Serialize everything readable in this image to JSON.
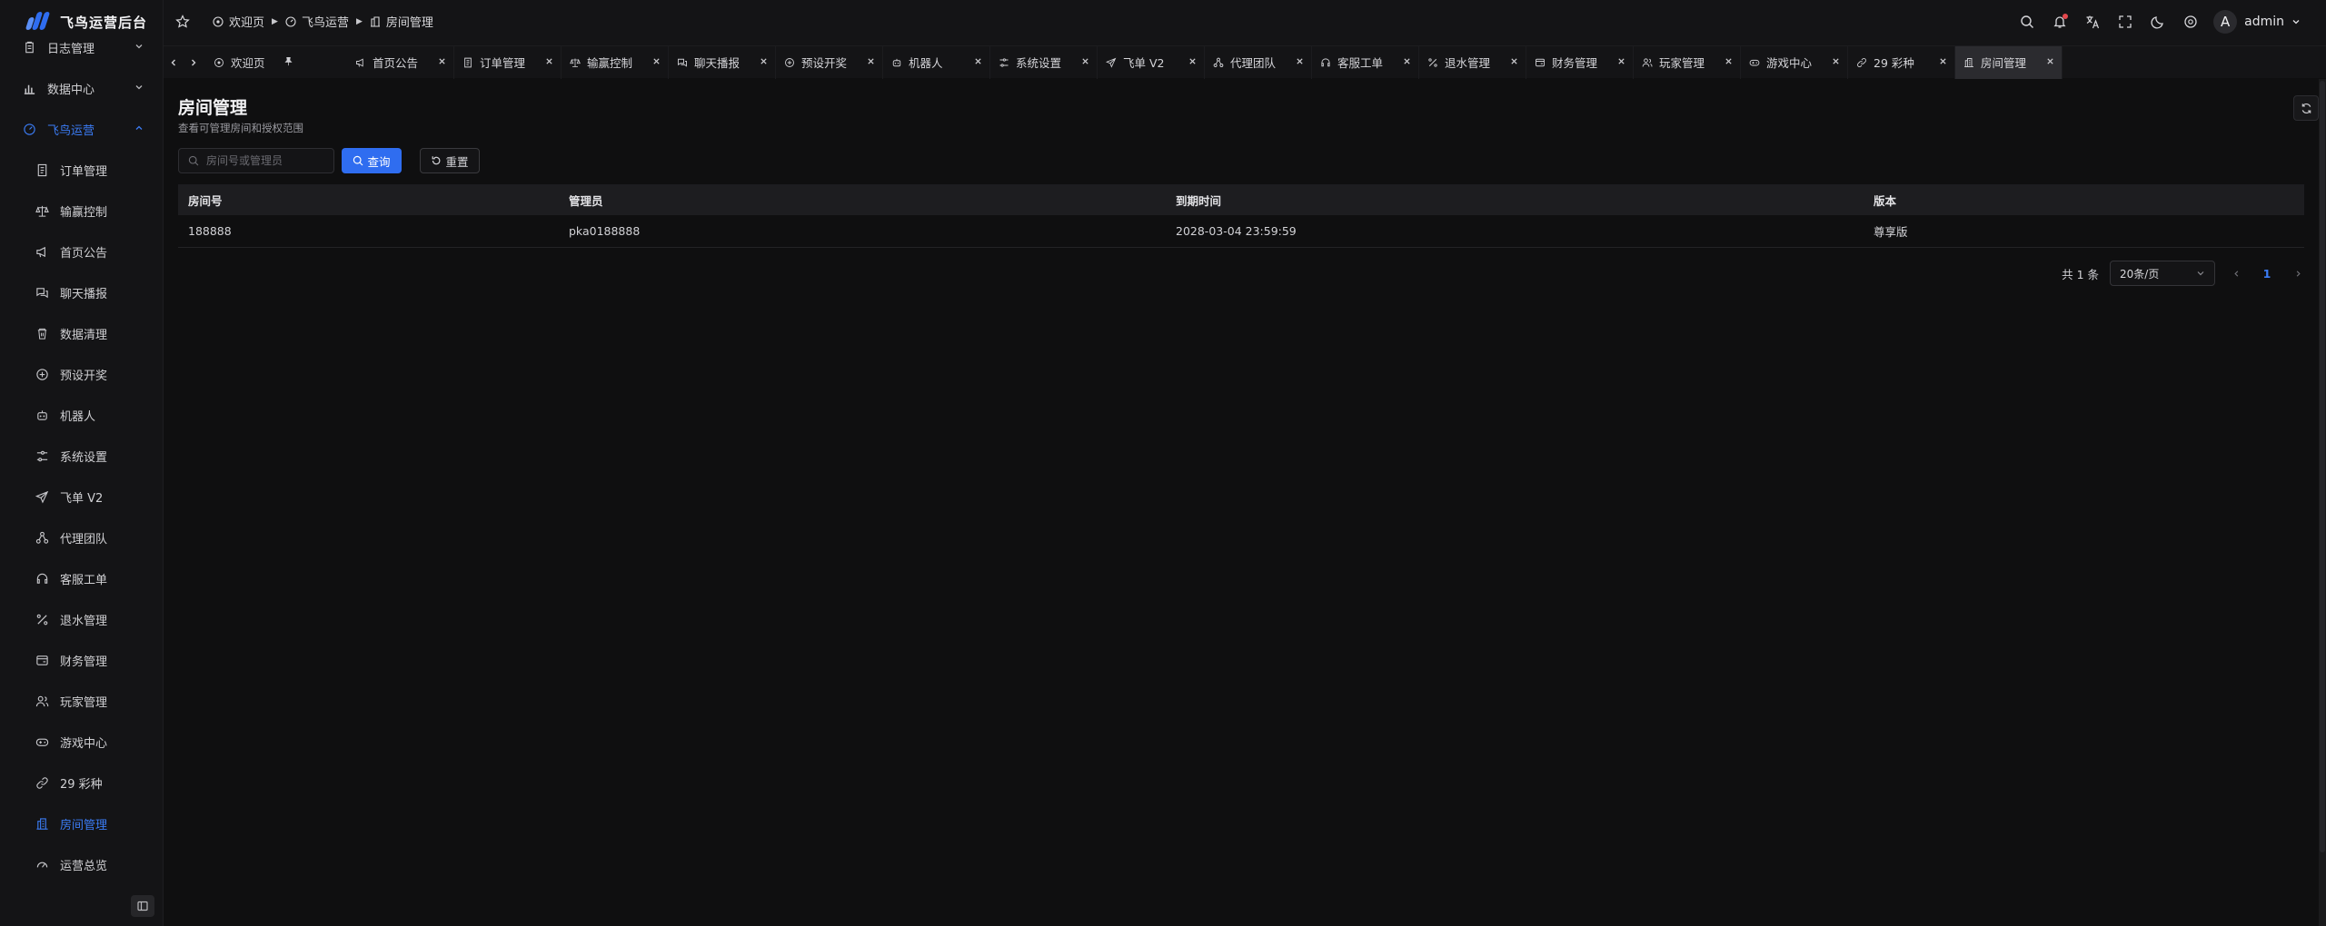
{
  "app": {
    "title": "飞鸟运营后台"
  },
  "sidebar": {
    "items": [
      {
        "label": "日志管理",
        "icon": "clipboard-icon",
        "top": true,
        "chevron": true
      },
      {
        "label": "数据中心",
        "icon": "chart-icon",
        "top": true,
        "chevron": true
      },
      {
        "label": "飞鸟运营",
        "icon": "gauge-icon",
        "top": true,
        "chevron": true,
        "open": true
      },
      {
        "label": "订单管理",
        "icon": "document-icon"
      },
      {
        "label": "输赢控制",
        "icon": "scale-icon"
      },
      {
        "label": "首页公告",
        "icon": "megaphone-icon"
      },
      {
        "label": "聊天播报",
        "icon": "chat-icon"
      },
      {
        "label": "数据清理",
        "icon": "cleanup-icon"
      },
      {
        "label": "预设开奖",
        "icon": "plus-circle-icon"
      },
      {
        "label": "机器人",
        "icon": "robot-icon"
      },
      {
        "label": "系统设置",
        "icon": "sliders-icon"
      },
      {
        "label": "飞单 V2",
        "icon": "send-icon"
      },
      {
        "label": "代理团队",
        "icon": "team-icon"
      },
      {
        "label": "客服工单",
        "icon": "headset-icon"
      },
      {
        "label": "退水管理",
        "icon": "percent-icon"
      },
      {
        "label": "财务管理",
        "icon": "wallet-icon"
      },
      {
        "label": "玩家管理",
        "icon": "users-icon"
      },
      {
        "label": "游戏中心",
        "icon": "gamepad-icon"
      },
      {
        "label": "29 彩种",
        "icon": "link-icon"
      },
      {
        "label": "房间管理",
        "icon": "building-icon",
        "active": true
      },
      {
        "label": "运营总览",
        "icon": "speedometer-icon"
      }
    ]
  },
  "header": {
    "breadcrumbs": [
      {
        "label": "欢迎页",
        "icon": "welcome-icon"
      },
      {
        "label": "飞鸟运营",
        "icon": "gauge-icon"
      },
      {
        "label": "房间管理",
        "icon": "building-icon"
      }
    ],
    "user": {
      "avatar": "A",
      "name": "admin"
    }
  },
  "tabs": [
    {
      "label": "欢迎页",
      "icon": "welcome-icon",
      "pinned": true
    },
    {
      "label": "首页公告",
      "icon": "megaphone-icon"
    },
    {
      "label": "订单管理",
      "icon": "document-icon"
    },
    {
      "label": "输赢控制",
      "icon": "scale-icon"
    },
    {
      "label": "聊天播报",
      "icon": "chat-icon"
    },
    {
      "label": "预设开奖",
      "icon": "plus-circle-icon"
    },
    {
      "label": "机器人",
      "icon": "robot-icon"
    },
    {
      "label": "系统设置",
      "icon": "sliders-icon"
    },
    {
      "label": "飞单 V2",
      "icon": "send-icon"
    },
    {
      "label": "代理团队",
      "icon": "team-icon"
    },
    {
      "label": "客服工单",
      "icon": "headset-icon"
    },
    {
      "label": "退水管理",
      "icon": "percent-icon"
    },
    {
      "label": "财务管理",
      "icon": "wallet-icon"
    },
    {
      "label": "玩家管理",
      "icon": "users-icon"
    },
    {
      "label": "游戏中心",
      "icon": "gamepad-icon"
    },
    {
      "label": "29 彩种",
      "icon": "link-icon"
    },
    {
      "label": "房间管理",
      "icon": "building-icon",
      "active": true
    }
  ],
  "page": {
    "title": "房间管理",
    "description": "查看可管理房间和授权范围",
    "search_placeholder": "房间号或管理员",
    "search_button": "查询",
    "reset_button": "重置"
  },
  "table": {
    "columns": [
      "房间号",
      "管理员",
      "到期时间",
      "版本"
    ],
    "rows": [
      [
        "188888",
        "pka0188888",
        "2028-03-04 23:59:59",
        "尊享版"
      ]
    ]
  },
  "pagination": {
    "total": "共 1 条",
    "page_size": "20条/页",
    "current": "1"
  },
  "colors": {
    "accent": "#2f6df0",
    "background": "#0f0f10",
    "sidebar": "#141416"
  }
}
